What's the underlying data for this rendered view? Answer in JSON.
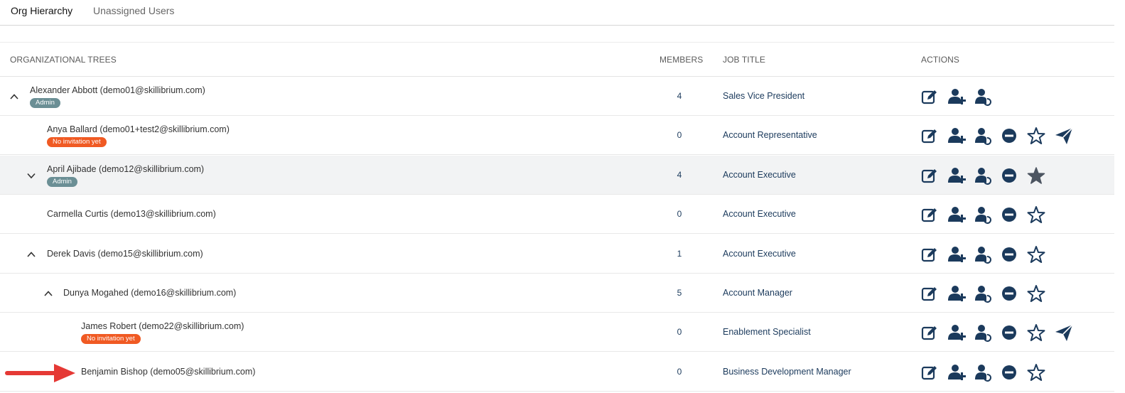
{
  "tabs": [
    {
      "label": "Org Hierarchy",
      "active": true
    },
    {
      "label": "Unassigned Users",
      "active": false
    }
  ],
  "table": {
    "headers": {
      "trees": "ORGANIZATIONAL TREES",
      "members": "MEMBERS",
      "job_title": "JOB TITLE",
      "actions": "ACTIONS"
    },
    "rows": [
      {
        "name": "Alexander Abbott (demo01@skillibrium.com)",
        "badge": "Admin",
        "badge_type": "admin",
        "members": "4",
        "job_title": "Sales Vice President",
        "expander": "chevron-up",
        "actions": [
          "edit",
          "add-user",
          "transfer-user"
        ]
      },
      {
        "name": "Anya  Ballard (demo01+test2@skillibrium.com)",
        "badge": "No invitation yet",
        "badge_type": "noinv",
        "members": "0",
        "job_title": "Account Representative",
        "expander": "",
        "actions": [
          "edit",
          "add-user",
          "transfer-user",
          "remove",
          "star-outline",
          "send"
        ]
      },
      {
        "name": "April Ajibade (demo12@skillibrium.com)",
        "badge": "Admin",
        "badge_type": "admin",
        "members": "4",
        "job_title": "Account Executive",
        "expander": "chevron-down",
        "highlighted": true,
        "actions": [
          "edit",
          "add-user",
          "transfer-user",
          "remove",
          "star-filled"
        ]
      },
      {
        "name": "Carmella Curtis (demo13@skillibrium.com)",
        "badge": "",
        "badge_type": "",
        "members": "0",
        "job_title": "Account Executive",
        "expander": "",
        "actions": [
          "edit",
          "add-user",
          "transfer-user",
          "remove",
          "star-outline"
        ]
      },
      {
        "name": "Derek Davis (demo15@skillibrium.com)",
        "badge": "",
        "badge_type": "",
        "members": "1",
        "job_title": "Account Executive",
        "expander": "chevron-up",
        "actions": [
          "edit",
          "add-user",
          "transfer-user",
          "remove",
          "star-outline"
        ]
      },
      {
        "name": "Dunya Mogahed (demo16@skillibrium.com)",
        "badge": "",
        "badge_type": "",
        "members": "5",
        "job_title": "Account Manager",
        "expander": "chevron-up",
        "actions": [
          "edit",
          "add-user",
          "transfer-user",
          "remove",
          "star-outline"
        ]
      },
      {
        "name": "James Robert (demo22@skillibrium.com)",
        "badge": "No invitation yet",
        "badge_type": "noinv",
        "members": "0",
        "job_title": "Enablement Specialist",
        "expander": "",
        "actions": [
          "edit",
          "add-user",
          "transfer-user",
          "remove",
          "star-outline",
          "send"
        ]
      },
      {
        "name": "Benjamin Bishop (demo05@skillibrium.com)",
        "badge": "",
        "badge_type": "",
        "members": "0",
        "job_title": "Business Development Manager",
        "expander": "",
        "actions": [
          "edit",
          "add-user",
          "transfer-user",
          "remove",
          "star-outline"
        ]
      }
    ]
  },
  "annotation": {
    "icon": "red-arrow-icon",
    "color": "#e53935"
  },
  "colors": {
    "icon": "#1b3a5c",
    "admin_badge": "#6b8f95",
    "noinv_badge": "#f05a23",
    "highlight_row": "#f2f3f4"
  }
}
